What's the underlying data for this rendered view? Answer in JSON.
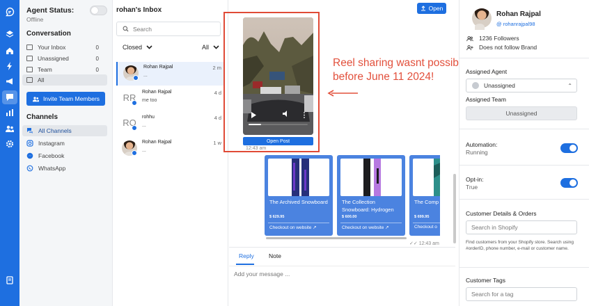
{
  "sidebar": {
    "agent_status_title": "Agent Status:",
    "agent_status_value": "Offline",
    "conversation_title": "Conversation",
    "items": [
      {
        "label": "Your Inbox",
        "count": "0"
      },
      {
        "label": "Unassigned",
        "count": "0"
      },
      {
        "label": "Team",
        "count": "0"
      },
      {
        "label": "All",
        "count": ""
      }
    ],
    "invite_label": "Invite Team Members",
    "channels_title": "Channels",
    "channels": [
      "All Channels",
      "Instagram",
      "Facebook",
      "WhatsApp"
    ]
  },
  "inbox": {
    "title": "rohan's Inbox",
    "search_placeholder": "Search",
    "filter_status": "Closed",
    "filter_scope": "All",
    "conversations": [
      {
        "name": "Rohan Rajpal",
        "message": "...",
        "time": "2 m",
        "initials": ""
      },
      {
        "name": "Rohan Rajpal",
        "message": "me too",
        "time": "4 d",
        "initials": "RR"
      },
      {
        "name": "rohhu",
        "message": "...",
        "time": "4 d",
        "initials": "RO"
      },
      {
        "name": "Rohan Rajpal",
        "message": "...",
        "time": "1 w",
        "initials": ""
      }
    ]
  },
  "chat": {
    "open_label": "Open",
    "open_post_label": "Open Post",
    "reel_time": "12:43 am",
    "annotation": "Reel sharing wasnt possible before June 11 2024!",
    "products": [
      {
        "title": "The Archived Snowboard",
        "price": "$ 629.95",
        "checkout": "Checkout on website"
      },
      {
        "title": "The Collection Snowboard: Hydrogen",
        "price": "$ 600.00",
        "checkout": "Checkout on website"
      },
      {
        "title": "The Comp Snowbo",
        "price": "$ 699.95",
        "checkout": "Checkout o"
      }
    ],
    "products_time": "12:43 am",
    "reply_tab": "Reply",
    "note_tab": "Note",
    "message_placeholder": "Add your message ..."
  },
  "profile": {
    "name": "Rohan Rajpal",
    "handle": "@ rohanrajpal98",
    "followers": "1236 Followers",
    "follow_status": "Does not follow Brand",
    "assigned_agent_label": "Assigned Agent",
    "assigned_agent_value": "Unassigned",
    "assigned_team_label": "Assigned Team",
    "assigned_team_value": "Unassigned",
    "automation_label": "Automation:",
    "automation_value": "Running",
    "optin_label": "Opt-in:",
    "optin_value": "True",
    "customer_details_label": "Customer Details & Orders",
    "shopify_placeholder": "Search in Shopify",
    "shopify_help": "Find customers from your Shopify store. Search using #orderID, phone number, e-mail or customer name.",
    "tags_label": "Customer Tags",
    "tags_placeholder": "Search for a tag"
  },
  "colors": {
    "accent": "#1e6fe0",
    "annotation": "#e2503c"
  }
}
